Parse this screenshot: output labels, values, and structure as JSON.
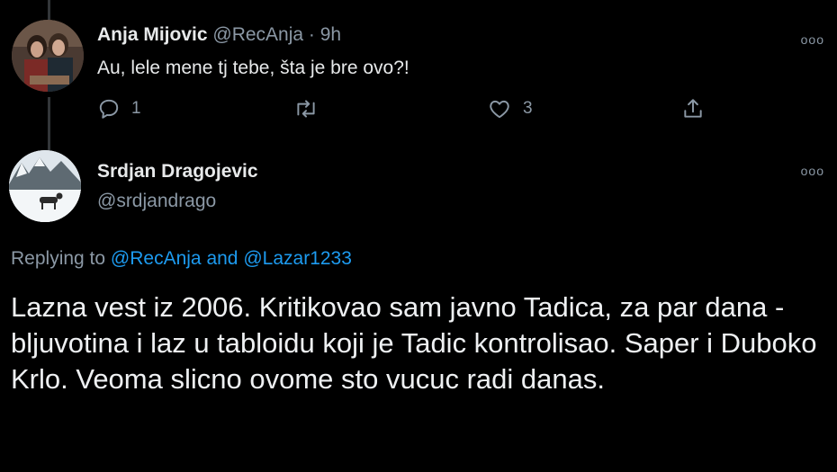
{
  "tweet1": {
    "name": "Anja Mijovic",
    "handle": "@RecAnja",
    "time": "· 9h",
    "text": "Au, lele mene tj tebe, šta je bre ovo?!",
    "reply_count": "1",
    "retweet_count": "",
    "like_count": "3",
    "more": "ooo"
  },
  "tweet2": {
    "name": "Srdjan Dragojevic",
    "handle": "@srdjandrago",
    "more": "ooo",
    "replying_prefix": "Replying to",
    "replying_user1": "@RecAnja",
    "replying_and": "and",
    "replying_user2": "@Lazar1233",
    "text": "Lazna vest iz 2006. Kritikovao sam javno Tadica, za par dana - bljuvotina i laz u tabloidu koji je Tadic kontrolisao. Saper i Duboko Krlo. Veoma slicno ovome sto vucuc radi danas."
  },
  "icons": [
    "reply-icon",
    "retweet-icon",
    "like-icon",
    "share-icon",
    "more-icon"
  ],
  "colors": {
    "background": "#000000",
    "text": "#e7e9ea",
    "muted": "#8b98a5",
    "link": "#1d9bf0"
  }
}
